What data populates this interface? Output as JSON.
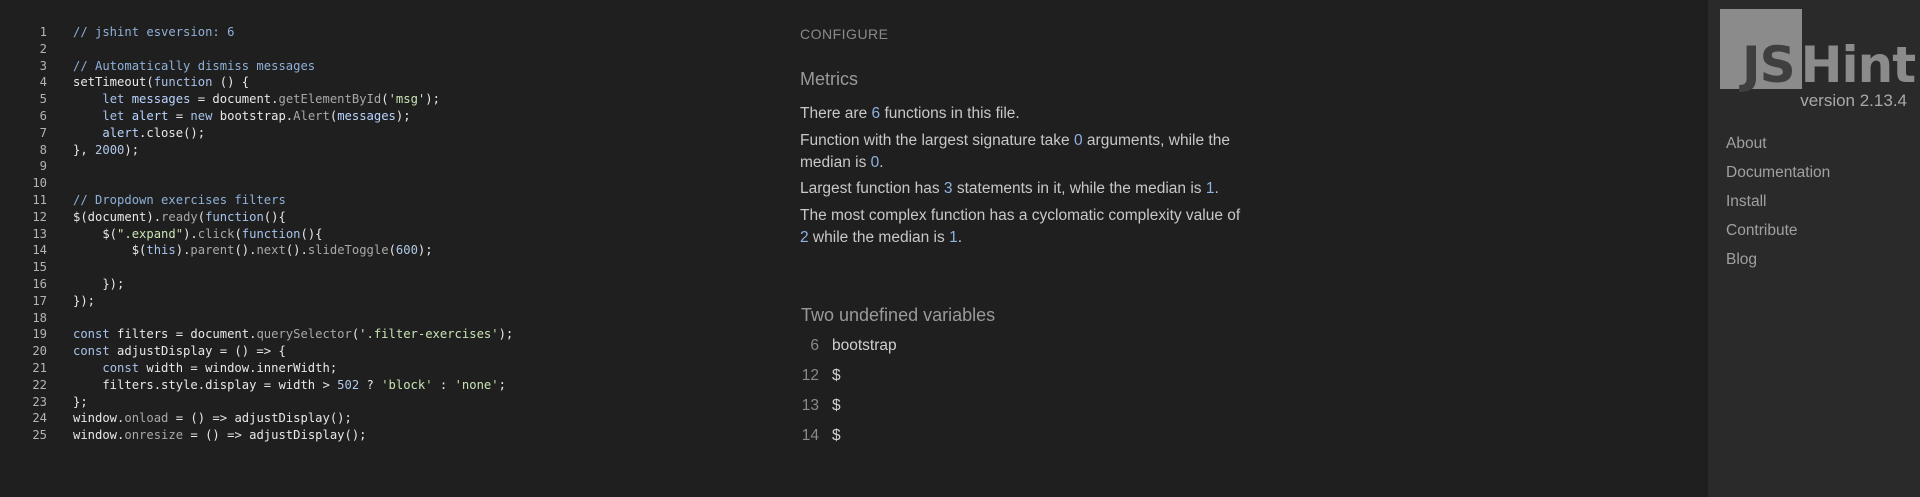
{
  "editor": {
    "lines": [
      {
        "n": "1",
        "tokens": [
          {
            "t": "// jshint esversion: 6",
            "c": "com"
          }
        ]
      },
      {
        "n": "2",
        "tokens": []
      },
      {
        "n": "3",
        "tokens": [
          {
            "t": "// Automatically dismiss messages",
            "c": "com"
          }
        ]
      },
      {
        "n": "4",
        "tokens": [
          {
            "t": "setTimeout(",
            "c": ""
          },
          {
            "t": "function",
            "c": "kw"
          },
          {
            "t": " () {",
            "c": ""
          }
        ]
      },
      {
        "n": "5",
        "tokens": [
          {
            "t": "    ",
            "c": ""
          },
          {
            "t": "let",
            "c": "kw"
          },
          {
            "t": " ",
            "c": ""
          },
          {
            "t": "messages",
            "c": "var"
          },
          {
            "t": " = document.",
            "c": ""
          },
          {
            "t": "getElementById",
            "c": "fn"
          },
          {
            "t": "(",
            "c": ""
          },
          {
            "t": "'msg'",
            "c": "str"
          },
          {
            "t": ");",
            "c": ""
          }
        ]
      },
      {
        "n": "6",
        "tokens": [
          {
            "t": "    ",
            "c": ""
          },
          {
            "t": "let",
            "c": "kw"
          },
          {
            "t": " ",
            "c": ""
          },
          {
            "t": "alert",
            "c": "var"
          },
          {
            "t": " = ",
            "c": ""
          },
          {
            "t": "new",
            "c": "kw"
          },
          {
            "t": " bootstrap.",
            "c": ""
          },
          {
            "t": "Alert",
            "c": "fn"
          },
          {
            "t": "(",
            "c": ""
          },
          {
            "t": "messages",
            "c": "var"
          },
          {
            "t": ");",
            "c": ""
          }
        ]
      },
      {
        "n": "7",
        "tokens": [
          {
            "t": "    ",
            "c": ""
          },
          {
            "t": "alert",
            "c": "var"
          },
          {
            "t": ".close();",
            "c": ""
          }
        ]
      },
      {
        "n": "8",
        "tokens": [
          {
            "t": "}, ",
            "c": ""
          },
          {
            "t": "2000",
            "c": "num"
          },
          {
            "t": ");",
            "c": ""
          }
        ]
      },
      {
        "n": "9",
        "tokens": []
      },
      {
        "n": "10",
        "tokens": []
      },
      {
        "n": "11",
        "tokens": [
          {
            "t": "// Dropdown exercises filters",
            "c": "com"
          }
        ]
      },
      {
        "n": "12",
        "tokens": [
          {
            "t": "$(document).",
            "c": ""
          },
          {
            "t": "ready",
            "c": "fn"
          },
          {
            "t": "(",
            "c": ""
          },
          {
            "t": "function",
            "c": "kw"
          },
          {
            "t": "(){",
            "c": ""
          }
        ]
      },
      {
        "n": "13",
        "tokens": [
          {
            "t": "    $(",
            "c": ""
          },
          {
            "t": "\".expand\"",
            "c": "str"
          },
          {
            "t": ").",
            "c": ""
          },
          {
            "t": "click",
            "c": "fn"
          },
          {
            "t": "(",
            "c": ""
          },
          {
            "t": "function",
            "c": "kw"
          },
          {
            "t": "(){",
            "c": ""
          }
        ]
      },
      {
        "n": "14",
        "tokens": [
          {
            "t": "        $(",
            "c": ""
          },
          {
            "t": "this",
            "c": "kw"
          },
          {
            "t": ").",
            "c": ""
          },
          {
            "t": "parent",
            "c": "fn"
          },
          {
            "t": "().",
            "c": ""
          },
          {
            "t": "next",
            "c": "fn"
          },
          {
            "t": "().",
            "c": ""
          },
          {
            "t": "slideToggle",
            "c": "fn"
          },
          {
            "t": "(",
            "c": ""
          },
          {
            "t": "600",
            "c": "num"
          },
          {
            "t": ");",
            "c": ""
          }
        ]
      },
      {
        "n": "15",
        "tokens": []
      },
      {
        "n": "16",
        "tokens": [
          {
            "t": "    });",
            "c": ""
          }
        ]
      },
      {
        "n": "17",
        "tokens": [
          {
            "t": "});",
            "c": ""
          }
        ]
      },
      {
        "n": "18",
        "tokens": []
      },
      {
        "n": "19",
        "tokens": [
          {
            "t": "const",
            "c": "kw"
          },
          {
            "t": " filters = document.",
            "c": ""
          },
          {
            "t": "querySelector",
            "c": "fn"
          },
          {
            "t": "(",
            "c": ""
          },
          {
            "t": "'.filter-exercises'",
            "c": "str"
          },
          {
            "t": ");",
            "c": ""
          }
        ]
      },
      {
        "n": "20",
        "tokens": [
          {
            "t": "const",
            "c": "kw"
          },
          {
            "t": " adjustDisplay = () => {",
            "c": ""
          }
        ]
      },
      {
        "n": "21",
        "tokens": [
          {
            "t": "    ",
            "c": ""
          },
          {
            "t": "const",
            "c": "kw"
          },
          {
            "t": " width = window.innerWidth;",
            "c": ""
          }
        ]
      },
      {
        "n": "22",
        "tokens": [
          {
            "t": "    filters.style.display = width > ",
            "c": ""
          },
          {
            "t": "502",
            "c": "num"
          },
          {
            "t": " ? ",
            "c": ""
          },
          {
            "t": "'block'",
            "c": "str"
          },
          {
            "t": " : ",
            "c": ""
          },
          {
            "t": "'none'",
            "c": "str"
          },
          {
            "t": ";",
            "c": ""
          }
        ]
      },
      {
        "n": "23",
        "tokens": [
          {
            "t": "};",
            "c": ""
          }
        ]
      },
      {
        "n": "24",
        "tokens": [
          {
            "t": "window.",
            "c": ""
          },
          {
            "t": "onload",
            "c": "fn"
          },
          {
            "t": " = () => adjustDisplay();",
            "c": ""
          }
        ]
      },
      {
        "n": "25",
        "tokens": [
          {
            "t": "window.",
            "c": ""
          },
          {
            "t": "onresize",
            "c": "fn"
          },
          {
            "t": " = () => adjustDisplay();",
            "c": ""
          }
        ]
      }
    ]
  },
  "report": {
    "configure_label": "CONFIGURE",
    "metrics_title": "Metrics",
    "metrics": {
      "functions": {
        "prefix": "There are ",
        "value": "6",
        "suffix": " functions in this file."
      },
      "signature": {
        "prefix": "Function with the largest signature take ",
        "value1": "0",
        "middle": " arguments, while the median is ",
        "value2": "0",
        "suffix": "."
      },
      "statements": {
        "prefix": "Largest function has ",
        "value1": "3",
        "middle": " statements in it, while the median is ",
        "value2": "1",
        "suffix": "."
      },
      "complexity": {
        "prefix": "The most complex function has a cyclomatic complexity value of ",
        "value1": "2",
        "middle": " while the median is ",
        "value2": "1",
        "suffix": "."
      }
    },
    "undefined_title": "Two undefined variables",
    "undefined_vars": [
      {
        "line": "6",
        "name": "bootstrap"
      },
      {
        "line": "12",
        "name": "$"
      },
      {
        "line": "13",
        "name": "$"
      },
      {
        "line": "14",
        "name": "$"
      }
    ]
  },
  "sidebar": {
    "logo": {
      "js": "JS",
      "hint": "Hint"
    },
    "version": "version 2.13.4",
    "nav": [
      "About",
      "Documentation",
      "Install",
      "Contribute",
      "Blog"
    ]
  },
  "colors": {
    "background": "#1f1f1f",
    "sidebar": "#2a2a2a",
    "highlight": "#8fb2e0",
    "logo_gray": "#8b8b8b"
  }
}
